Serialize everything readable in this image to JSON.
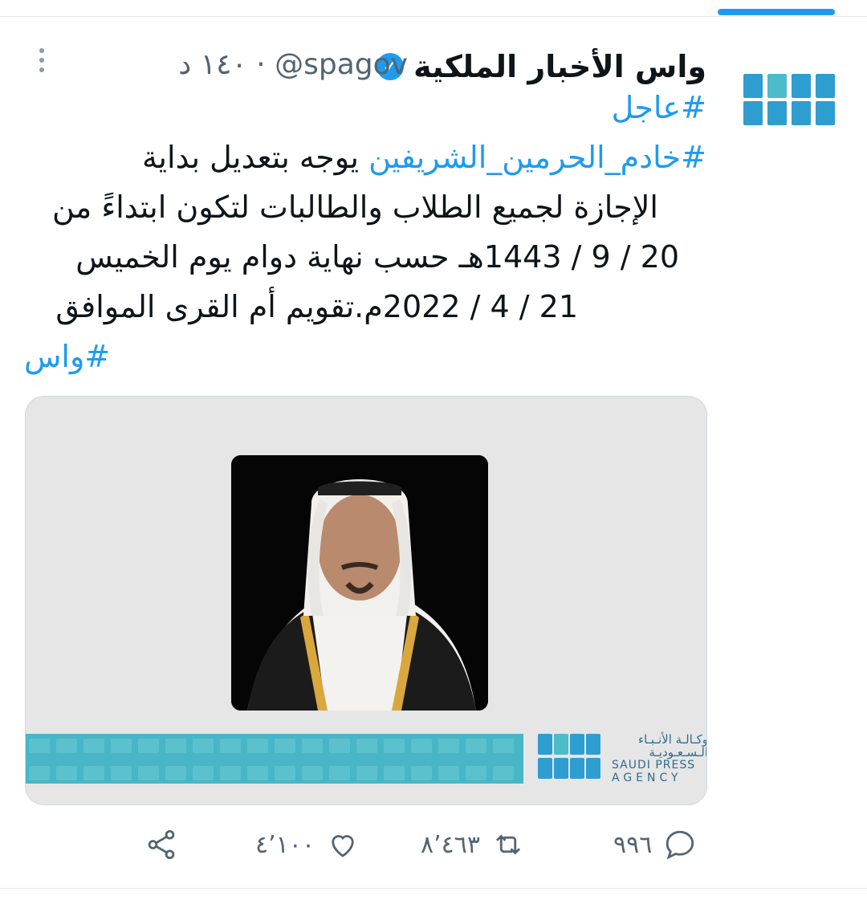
{
  "tweet": {
    "display_name": "واس الأخبار الملكية",
    "handle": "@spagov",
    "time": "١٤٠ د",
    "separator": "·",
    "hashtag_urgent": "#عاجل",
    "line1_hashtag": "#خادم_الحرمين_الشريفين",
    "line1_text": "يوجه بتعديل بداية",
    "line2": "الإجازة لجميع الطلاب والطالبات لتكون ابتداءً من",
    "line3": "20 / 9 / 1443هـ حسب نهاية دوام يوم الخميس",
    "line4": "21 / 4 / 2022م.تقويم أم القرى الموافق",
    "hashtag_spa": "#واس"
  },
  "media": {
    "agency_ar1": "وكـالـة الأنـبـاء",
    "agency_ar2": "الـسـعـوديـة",
    "agency_en1": "SAUDI PRESS",
    "agency_en2": "AGENCY"
  },
  "actions": {
    "reply_count": "٩٩٦",
    "retweet_count": "٨٬٤٦٣",
    "like_count": "٤٬١٠٠"
  },
  "colors": {
    "accent": "#1d9bf0",
    "muted": "#536471",
    "spa_blue": "#2e9dd0",
    "spa_teal": "#48b6c7"
  }
}
